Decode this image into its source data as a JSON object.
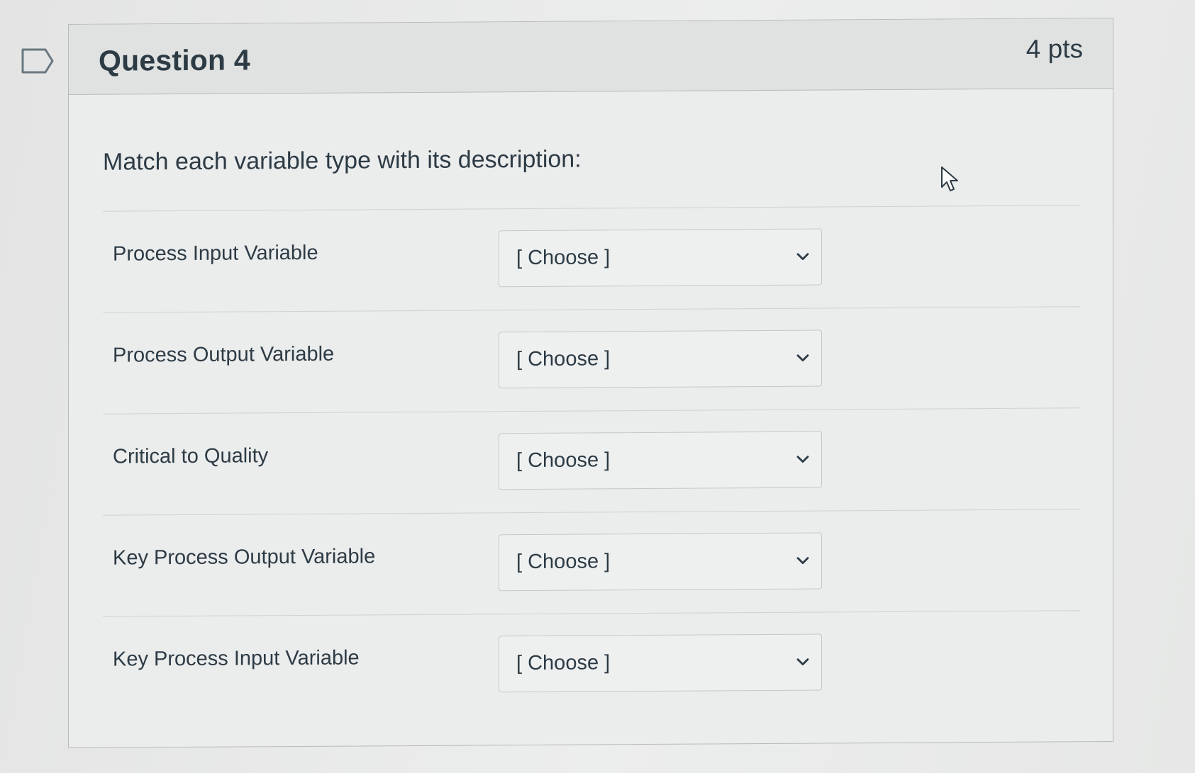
{
  "question": {
    "title": "Question 4",
    "points": "4 pts",
    "prompt": "Match each variable type with its description:"
  },
  "rows": [
    {
      "label": "Process Input Variable",
      "select_value": "[ Choose ]"
    },
    {
      "label": "Process Output Variable",
      "select_value": "[ Choose ]"
    },
    {
      "label": "Critical to Quality",
      "select_value": "[ Choose ]"
    },
    {
      "label": "Key Process Output Variable",
      "select_value": "[ Choose ]"
    },
    {
      "label": "Key Process Input Variable",
      "select_value": "[ Choose ]"
    }
  ],
  "icons": {
    "bookmark": "bookmark-flag-icon",
    "chevron": "chevron-down-icon",
    "cursor": "mouse-pointer-icon"
  },
  "colors": {
    "text": "#2d3b45",
    "header_bg": "#e0e2e2",
    "border": "#b7bbbd"
  }
}
